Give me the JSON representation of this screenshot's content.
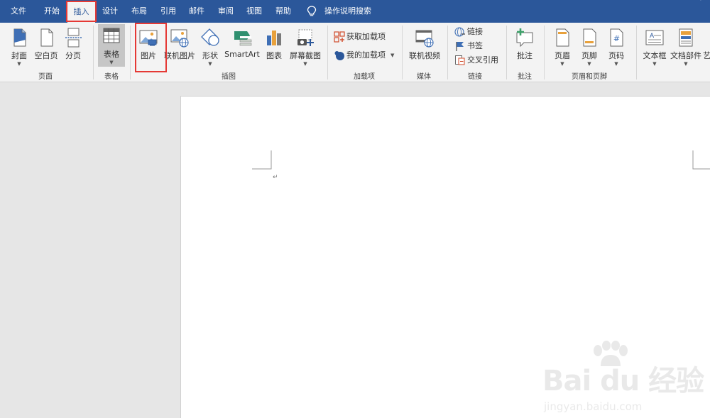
{
  "tabs": [
    {
      "label": "文件",
      "active": false
    },
    {
      "label": "开始",
      "active": false
    },
    {
      "label": "插入",
      "active": true
    },
    {
      "label": "设计",
      "active": false
    },
    {
      "label": "布局",
      "active": false
    },
    {
      "label": "引用",
      "active": false
    },
    {
      "label": "邮件",
      "active": false
    },
    {
      "label": "审阅",
      "active": false
    },
    {
      "label": "视图",
      "active": false
    },
    {
      "label": "帮助",
      "active": false
    }
  ],
  "tell_me": {
    "label": "操作说明搜索",
    "icon": "lightbulb-icon"
  },
  "ribbon": {
    "pages": {
      "group_label": "页面",
      "cover": "封面",
      "blank_page": "空白页",
      "page_break": "分页"
    },
    "tables": {
      "group_label": "表格",
      "table": "表格"
    },
    "illustrations": {
      "group_label": "插图",
      "picture": "图片",
      "online_picture": "联机图片",
      "shapes": "形状",
      "smartart": "SmartArt",
      "chart": "图表",
      "screenshot": "屏幕截图"
    },
    "addins": {
      "group_label": "加载项",
      "get_addins": "获取加载项",
      "my_addins": "我的加载项"
    },
    "media": {
      "group_label": "媒体",
      "online_video": "联机视频"
    },
    "links": {
      "group_label": "链接",
      "link": "链接",
      "bookmark": "书签",
      "cross_reference": "交叉引用"
    },
    "comments": {
      "group_label": "批注",
      "comment": "批注"
    },
    "header_footer": {
      "group_label": "页眉和页脚",
      "header": "页眉",
      "footer": "页脚",
      "page_number": "页码"
    },
    "text": {
      "text_box": "文本框",
      "quick_parts": "文档部件",
      "wordart": "艺"
    }
  },
  "document": {
    "paragraph_mark": "↵"
  },
  "watermark": {
    "brand": "Bai   du 经验",
    "url": "jingyan.baidu.com"
  },
  "colors": {
    "accent": "#2b579a",
    "highlight": "#e53935",
    "ribbon_bg": "#f3f3f3",
    "canvas": "#e6e6e6"
  }
}
